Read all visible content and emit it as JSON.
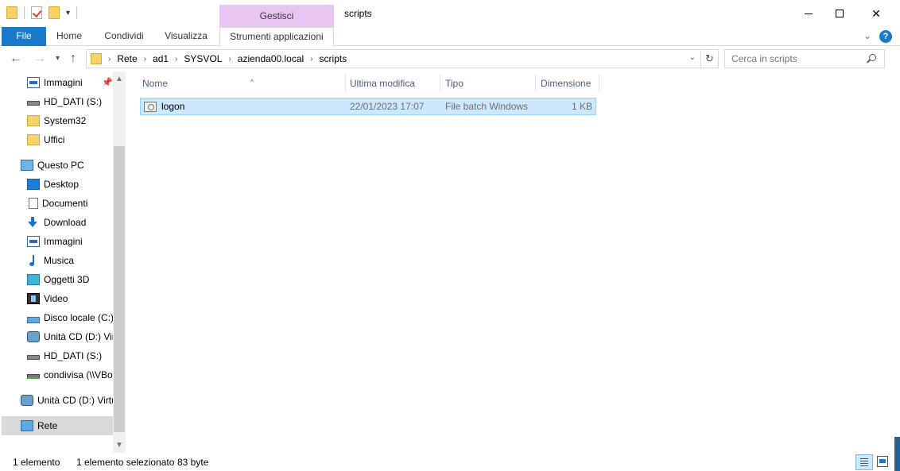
{
  "window": {
    "title": "scripts",
    "context_tab": "Gestisci",
    "minimize_glyph": "",
    "maximize_glyph": "",
    "close_glyph": "✕"
  },
  "ribbon": {
    "tabs": [
      "File",
      "Home",
      "Condividi",
      "Visualizza",
      "Strumenti applicazioni"
    ],
    "collapse_glyph": "⌄",
    "help_glyph": "?"
  },
  "address": {
    "crumbs": [
      "Rete",
      "ad1",
      "SYSVOL",
      "azienda00.local",
      "scripts"
    ],
    "search_placeholder": "Cerca in scripts"
  },
  "navigation": {
    "items": [
      {
        "label": "Immagini",
        "icon": "pictures-icon",
        "pinned": true
      },
      {
        "label": "HD_DATI (S:)",
        "icon": "drive-icon"
      },
      {
        "label": "System32",
        "icon": "folder-icon"
      },
      {
        "label": "Uffici",
        "icon": "folder-icon"
      },
      {
        "label": "Questo PC",
        "icon": "pc-icon"
      },
      {
        "label": "Desktop",
        "icon": "desktop-icon"
      },
      {
        "label": "Documenti",
        "icon": "documents-icon"
      },
      {
        "label": "Download",
        "icon": "download-icon"
      },
      {
        "label": "Immagini",
        "icon": "pictures-icon"
      },
      {
        "label": "Musica",
        "icon": "music-icon"
      },
      {
        "label": "Oggetti 3D",
        "icon": "3d-objects-icon"
      },
      {
        "label": "Video",
        "icon": "video-icon"
      },
      {
        "label": "Disco locale (C:)",
        "icon": "local-disk-icon"
      },
      {
        "label": "Unità CD (D:) Vir",
        "icon": "cd-drive-icon"
      },
      {
        "label": "HD_DATI (S:)",
        "icon": "drive-icon"
      },
      {
        "label": "condivisa (\\\\VBo",
        "icon": "network-drive-icon"
      },
      {
        "label": "Unità CD (D:) Virtu",
        "icon": "cd-drive-icon"
      },
      {
        "label": "Rete",
        "icon": "network-icon",
        "selected": true
      }
    ]
  },
  "columns": [
    "Nome",
    "Ultima modifica",
    "Tipo",
    "Dimensione"
  ],
  "files": [
    {
      "name": "logon",
      "modified": "22/01/2023 17:07",
      "type": "File batch Windows",
      "size": "1 KB",
      "selected": true
    }
  ],
  "status": {
    "count": "1 elemento",
    "selection": "1 elemento selezionato",
    "size": "83 byte"
  }
}
